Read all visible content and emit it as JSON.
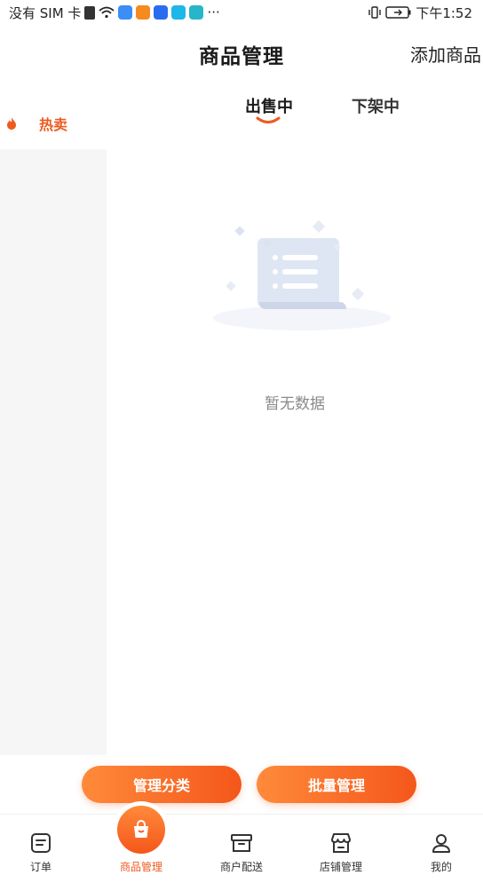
{
  "status_bar": {
    "carrier": "没有 SIM 卡",
    "time": "下午1:52",
    "more": "···"
  },
  "header": {
    "title": "商品管理",
    "add_button": "添加商品"
  },
  "sidebar": {
    "items": [
      {
        "label": "热卖",
        "icon": "flame-icon",
        "active": true
      }
    ]
  },
  "tabs": [
    {
      "label": "出售中",
      "active": true
    },
    {
      "label": "下架中",
      "active": false
    }
  ],
  "empty_state": {
    "text": "暂无数据",
    "icon": "empty-document-icon"
  },
  "actions": {
    "manage_category": "管理分类",
    "batch_manage": "批量管理"
  },
  "bottom_nav": {
    "items": [
      {
        "label": "订单",
        "icon": "order-icon"
      },
      {
        "label": "商品管理",
        "icon": "shopping-bag-icon",
        "active": true
      },
      {
        "label": "商户配送",
        "icon": "delivery-box-icon"
      },
      {
        "label": "店铺管理",
        "icon": "store-icon"
      },
      {
        "label": "我的",
        "icon": "user-icon"
      }
    ]
  },
  "colors": {
    "accent": "#f4571b",
    "accent_light": "#ff8a3a",
    "sidebar_bg": "#f6f6f6"
  }
}
